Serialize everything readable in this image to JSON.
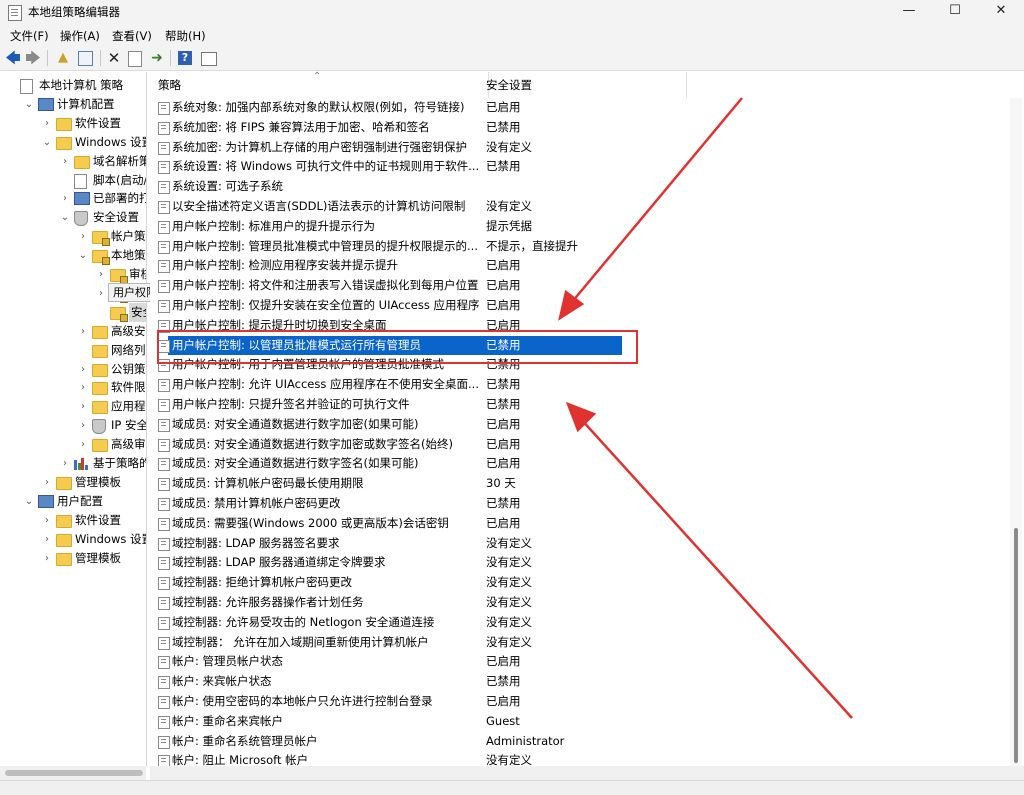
{
  "window": {
    "title": "本地组策略编辑器",
    "minimize_glyph": "—",
    "maximize_glyph": "☐",
    "close_glyph": "✕"
  },
  "menu": [
    "文件(F)",
    "操作(A)",
    "查看(V)",
    "帮助(H)"
  ],
  "toolbar_icons": [
    "back-arrow-icon",
    "forward-arrow-icon",
    "up-folder-icon",
    "show-tree-icon",
    "delete-icon",
    "properties-icon",
    "export-list-icon",
    "help-icon",
    "view-icon"
  ],
  "tree": [
    {
      "label": "本地计算机 策略",
      "indent": 0,
      "chev": "",
      "icon": "doc"
    },
    {
      "label": "计算机配置",
      "indent": 1,
      "chev": "⌄",
      "icon": "computer"
    },
    {
      "label": "软件设置",
      "indent": 2,
      "chev": "›",
      "icon": "folder"
    },
    {
      "label": "Windows 设置",
      "indent": 2,
      "chev": "⌄",
      "icon": "folder"
    },
    {
      "label": "域名解析策略",
      "indent": 3,
      "chev": "›",
      "icon": "folder"
    },
    {
      "label": "脚本(启动/关",
      "indent": 3,
      "chev": "",
      "icon": "doc"
    },
    {
      "label": "已部署的打印",
      "indent": 3,
      "chev": "›",
      "icon": "computer"
    },
    {
      "label": "安全设置",
      "indent": 3,
      "chev": "⌄",
      "icon": "shield"
    },
    {
      "label": "帐户策略",
      "indent": 4,
      "chev": "›",
      "icon": "lockfolder"
    },
    {
      "label": "本地策略",
      "indent": 4,
      "chev": "⌄",
      "icon": "lockfolder"
    },
    {
      "label": "审核策",
      "indent": 5,
      "chev": "›",
      "icon": "lockfolder"
    },
    {
      "label": "",
      "indent": 5,
      "chev": "›",
      "icon": "lockfolder"
    },
    {
      "label": "安全选",
      "indent": 5,
      "chev": "",
      "icon": "lockfolder",
      "selected": true
    },
    {
      "label": "高级安全",
      "indent": 4,
      "chev": "›",
      "icon": "folder"
    },
    {
      "label": "网络列表",
      "indent": 4,
      "chev": "",
      "icon": "folder"
    },
    {
      "label": "公钥策略",
      "indent": 4,
      "chev": "›",
      "icon": "folder"
    },
    {
      "label": "软件限制",
      "indent": 4,
      "chev": "›",
      "icon": "folder"
    },
    {
      "label": "应用程序",
      "indent": 4,
      "chev": "›",
      "icon": "folder"
    },
    {
      "label": "IP 安全策",
      "indent": 4,
      "chev": "›",
      "icon": "shield"
    },
    {
      "label": "高级审核",
      "indent": 4,
      "chev": "›",
      "icon": "folder"
    },
    {
      "label": "基于策略的 C",
      "indent": 3,
      "chev": "›",
      "icon": "chart"
    },
    {
      "label": "管理模板",
      "indent": 2,
      "chev": "›",
      "icon": "folder"
    },
    {
      "label": "用户配置",
      "indent": 1,
      "chev": "⌄",
      "icon": "computer"
    },
    {
      "label": "软件设置",
      "indent": 2,
      "chev": "›",
      "icon": "folder"
    },
    {
      "label": "Windows 设置",
      "indent": 2,
      "chev": "›",
      "icon": "folder"
    },
    {
      "label": "管理模板",
      "indent": 2,
      "chev": "›",
      "icon": "folder"
    }
  ],
  "tooltip": "用户权限分配",
  "columns": {
    "policy": "策略",
    "setting": "安全设置"
  },
  "policies": [
    {
      "name": "系统对象: 加强内部系统对象的默认权限(例如，符号链接)",
      "value": "已启用"
    },
    {
      "name": "系统加密: 将 FIPS 兼容算法用于加密、哈希和签名",
      "value": "已禁用"
    },
    {
      "name": "系统加密: 为计算机上存储的用户密钥强制进行强密钥保护",
      "value": "没有定义"
    },
    {
      "name": "系统设置: 将 Windows 可执行文件中的证书规则用于软件...",
      "value": "已禁用"
    },
    {
      "name": "系统设置: 可选子系统",
      "value": ""
    },
    {
      "name": "以安全描述符定义语言(SDDL)语法表示的计算机访问限制",
      "value": "没有定义"
    },
    {
      "name": "用户帐户控制: 标准用户的提升提示行为",
      "value": "提示凭据"
    },
    {
      "name": "用户帐户控制: 管理员批准模式中管理员的提升权限提示的...",
      "value": "不提示，直接提升"
    },
    {
      "name": "用户帐户控制: 检测应用程序安装并提示提升",
      "value": "已启用"
    },
    {
      "name": "用户帐户控制: 将文件和注册表写入错误虚拟化到每用户位置",
      "value": "已启用"
    },
    {
      "name": "用户帐户控制: 仅提升安装在安全位置的 UIAccess 应用程序",
      "value": "已启用"
    },
    {
      "name": "用户帐户控制: 提示提升时切换到安全桌面",
      "value": "已启用"
    },
    {
      "name": "用户帐户控制: 以管理员批准模式运行所有管理员",
      "value": "已禁用",
      "selected": true
    },
    {
      "name": "用户帐户控制: 用于内置管理员帐户的管理员批准模式",
      "value": "已禁用"
    },
    {
      "name": "用户帐户控制: 允许 UIAccess 应用程序在不使用安全桌面...",
      "value": "已禁用"
    },
    {
      "name": "用户帐户控制: 只提升签名并验证的可执行文件",
      "value": "已禁用"
    },
    {
      "name": "域成员: 对安全通道数据进行数字加密(如果可能)",
      "value": "已启用"
    },
    {
      "name": "域成员: 对安全通道数据进行数字加密或数字签名(始终)",
      "value": "已启用"
    },
    {
      "name": "域成员: 对安全通道数据进行数字签名(如果可能)",
      "value": "已启用"
    },
    {
      "name": "域成员: 计算机帐户密码最长使用期限",
      "value": "30 天"
    },
    {
      "name": "域成员: 禁用计算机帐户密码更改",
      "value": "已禁用"
    },
    {
      "name": "域成员: 需要强(Windows 2000 或更高版本)会话密钥",
      "value": "已启用"
    },
    {
      "name": "域控制器: LDAP 服务器签名要求",
      "value": "没有定义"
    },
    {
      "name": "域控制器: LDAP 服务器通道绑定令牌要求",
      "value": "没有定义"
    },
    {
      "name": "域控制器: 拒绝计算机帐户密码更改",
      "value": "没有定义"
    },
    {
      "name": "域控制器: 允许服务器操作者计划任务",
      "value": "没有定义"
    },
    {
      "name": "域控制器: 允许易受攻击的 Netlogon 安全通道连接",
      "value": "没有定义"
    },
    {
      "name": "域控制器： 允许在加入域期间重新使用计算机帐户",
      "value": "没有定义"
    },
    {
      "name": "帐户: 管理员帐户状态",
      "value": "已启用"
    },
    {
      "name": "帐户: 来宾帐户状态",
      "value": "已禁用"
    },
    {
      "name": "帐户: 使用空密码的本地帐户只允许进行控制台登录",
      "value": "已启用"
    },
    {
      "name": "帐户: 重命名来宾帐户",
      "value": "Guest"
    },
    {
      "name": "帐户: 重命名系统管理员帐户",
      "value": "Administrator"
    },
    {
      "name": "帐户: 阻止 Microsoft 帐户",
      "value": "没有定义"
    }
  ],
  "colors": {
    "selection": "#0a64c9",
    "annotation": "#e0322f",
    "folder": "#f5cc4f"
  }
}
